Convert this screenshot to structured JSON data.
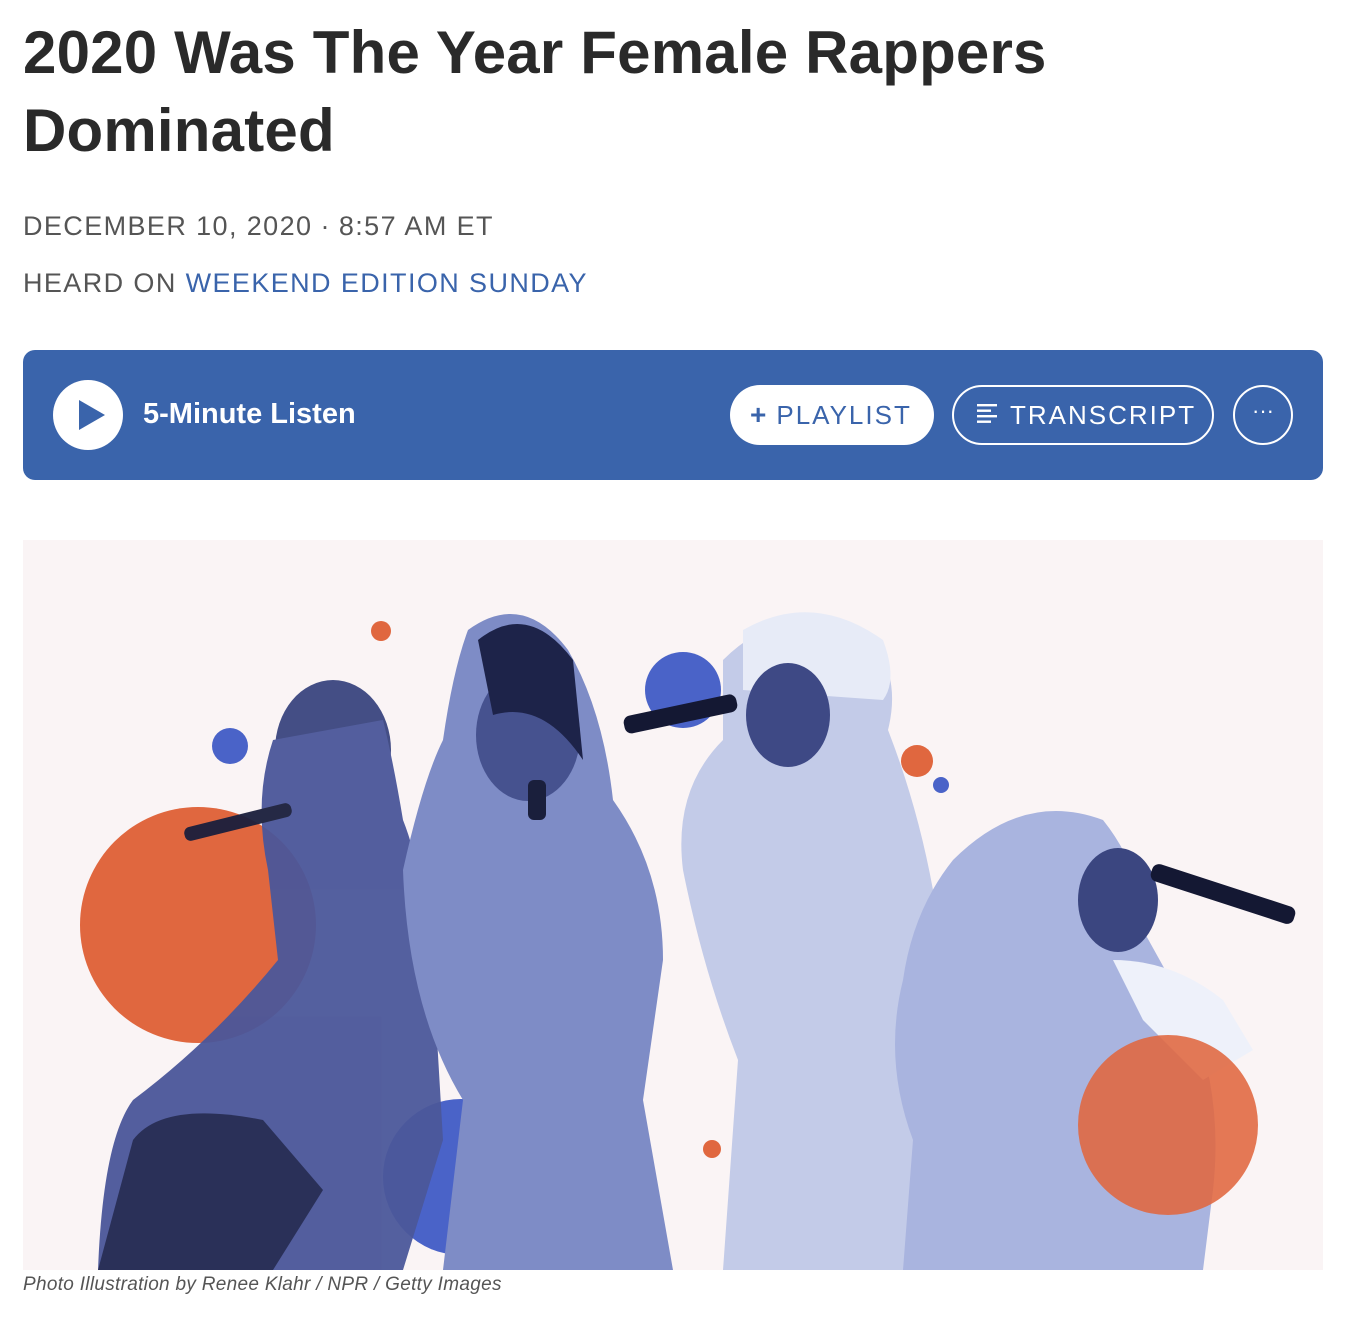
{
  "article": {
    "title": "2020 Was The Year Female Rappers Dominated",
    "date": "DECEMBER 10, 2020",
    "separator": "·",
    "time": "8:57 AM ET",
    "heard_on_prefix": "HEARD ON",
    "heard_on_show": "WEEKEND EDITION SUNDAY"
  },
  "player": {
    "listen_label": "5-Minute Listen",
    "playlist_label": "PLAYLIST",
    "playlist_icon": "plus-icon",
    "transcript_label": "TRANSCRIPT",
    "transcript_icon": "lines-icon",
    "more_label": "···",
    "play_icon": "play-icon"
  },
  "image": {
    "caption": "Photo Illustration by Renee Klahr / NPR / Getty Images"
  },
  "colors": {
    "accent_blue": "#3a64ab",
    "orange": "#e0673f",
    "image_blue": "#4a63c8",
    "figure_tint": "#8d9bd0",
    "background": "#faf4f5"
  }
}
